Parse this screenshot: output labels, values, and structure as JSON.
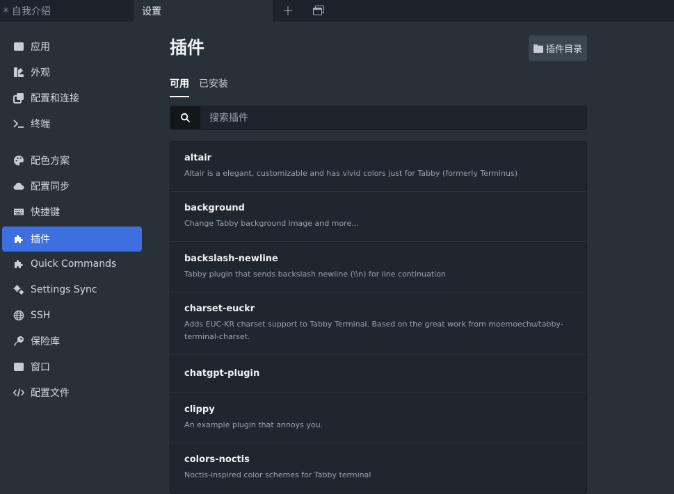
{
  "tabs": [
    {
      "label": "自我介绍",
      "modified_marker": "✳",
      "active": false
    },
    {
      "label": "设置",
      "active": true
    }
  ],
  "tabbar": {
    "new_tab_icon": "plus-icon",
    "window_icon": "window-restore-icon"
  },
  "sidebar": {
    "items": [
      {
        "label": "应用",
        "icon": "window-icon"
      },
      {
        "label": "外观",
        "icon": "paint-swatch-icon"
      },
      {
        "label": "配置和连接",
        "icon": "clone-icon"
      },
      {
        "label": "终端",
        "icon": "terminal-prompt-icon"
      },
      {
        "label": "配色方案",
        "icon": "palette-icon"
      },
      {
        "label": "配置同步",
        "icon": "cloud-icon"
      },
      {
        "label": "快捷键",
        "icon": "keyboard-icon"
      },
      {
        "label": "插件",
        "icon": "puzzle-icon",
        "active": true
      },
      {
        "label": "Quick Commands",
        "icon": "puzzle-icon"
      },
      {
        "label": "Settings Sync",
        "icon": "gears-icon"
      },
      {
        "label": "SSH",
        "icon": "globe-icon"
      },
      {
        "label": "保险库",
        "icon": "key-icon"
      },
      {
        "label": "窗口",
        "icon": "window-icon"
      },
      {
        "label": "配置文件",
        "icon": "code-icon"
      }
    ]
  },
  "main": {
    "title": "插件",
    "directory_button": "插件目录",
    "subtabs": [
      {
        "label": "可用",
        "active": true
      },
      {
        "label": "已安装",
        "active": false
      }
    ],
    "search": {
      "placeholder": "搜索插件",
      "value": ""
    },
    "plugins": [
      {
        "name": "altair",
        "description": "Altair is a elegant, customizable and has vivid colors just for Tabby (formerly Terminus)"
      },
      {
        "name": "background",
        "description": "Change Tabby background image and more..."
      },
      {
        "name": "backslash-newline",
        "description": "Tabby plugin that sends backslash newline (\\\\n) for line continuation"
      },
      {
        "name": "charset-euckr",
        "description": "Adds EUC-KR charset support to Tabby Terminal. Based on the great work from moemoechu/tabby-terminal-charset."
      },
      {
        "name": "chatgpt-plugin",
        "description": ""
      },
      {
        "name": "clippy",
        "description": "An example plugin that annoys you."
      },
      {
        "name": "colors-noctis",
        "description": "Noctis-inspired color schemes for Tabby terminal"
      }
    ]
  },
  "colors": {
    "accent": "#3e6fe0",
    "background": "#283038",
    "tabbar": "#1c232a",
    "list_bg": "#1f262d"
  }
}
